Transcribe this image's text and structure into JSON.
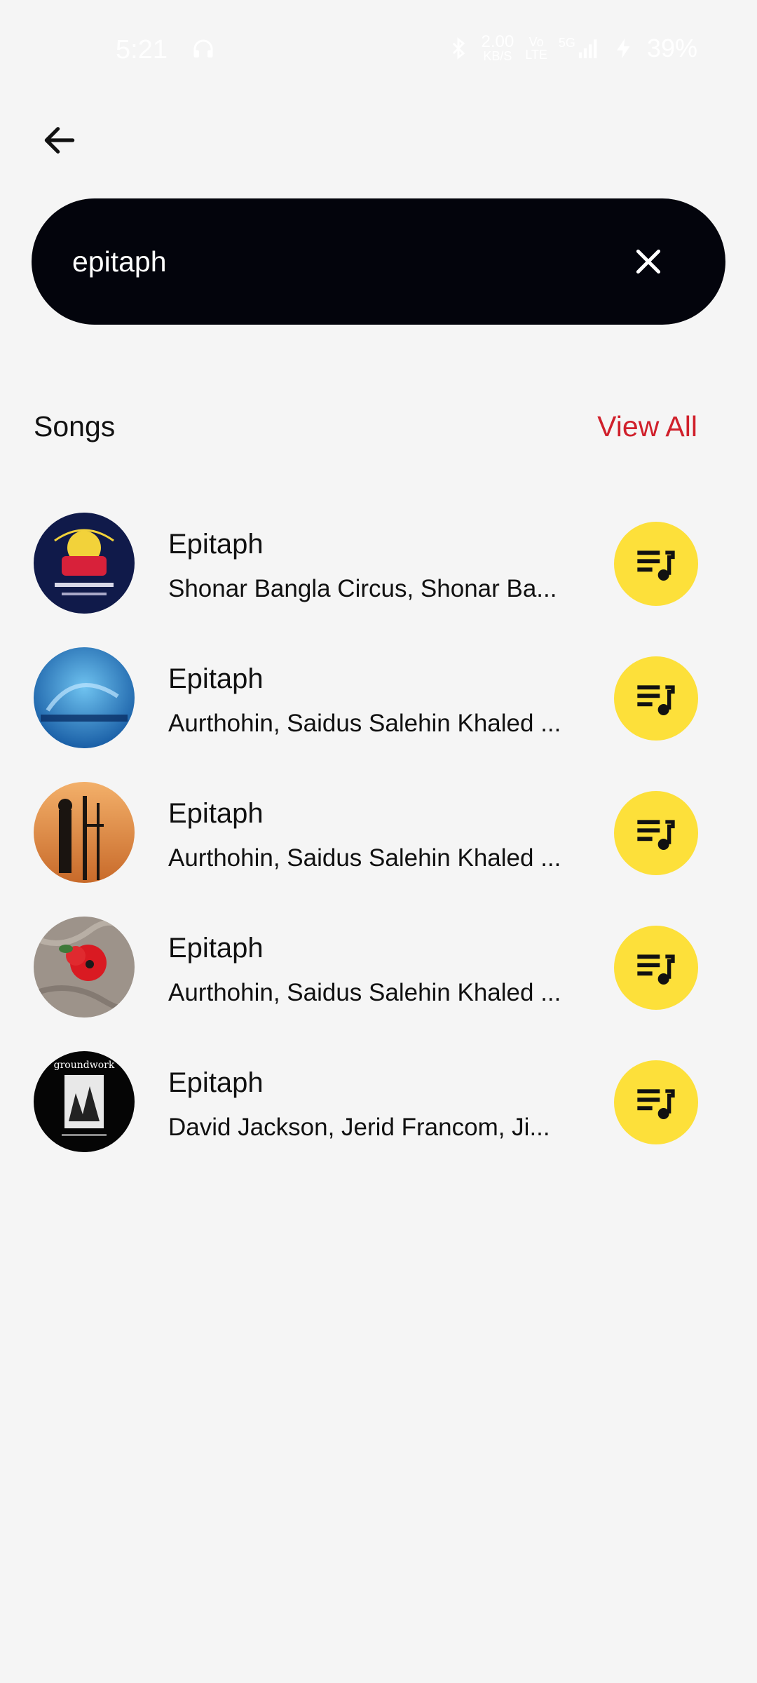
{
  "status_bar": {
    "time": "5:21",
    "net_speed_top": "2.00",
    "net_speed_bottom": "KB/S",
    "network_type_top": "Vo",
    "network_type_bottom": "LTE",
    "signal_label": "5G",
    "battery": "39%"
  },
  "search": {
    "value": "epitaph",
    "placeholder": "Search"
  },
  "section": {
    "title": "Songs",
    "view_all": "View All"
  },
  "songs": [
    {
      "title": "Epitaph",
      "artists": "Shonar Bangla Circus, Shonar Ba..."
    },
    {
      "title": "Epitaph",
      "artists": "Aurthohin, Saidus Salehin Khaled ..."
    },
    {
      "title": "Epitaph",
      "artists": "Aurthohin, Saidus Salehin Khaled ..."
    },
    {
      "title": "Epitaph",
      "artists": "Aurthohin, Saidus Salehin Khaled ..."
    },
    {
      "title": "Epitaph",
      "artists": "David Jackson, Jerid Francom, Ji..."
    }
  ],
  "artwork_5_text": "groundwork",
  "colors": {
    "background": "#f5f5f5",
    "search_bar": "#03040c",
    "accent_yellow": "#fde03a",
    "view_all_red": "#d0202b"
  },
  "icons": {
    "back": "arrow-left-icon",
    "clear": "close-icon",
    "queue": "playlist-add-icon"
  }
}
